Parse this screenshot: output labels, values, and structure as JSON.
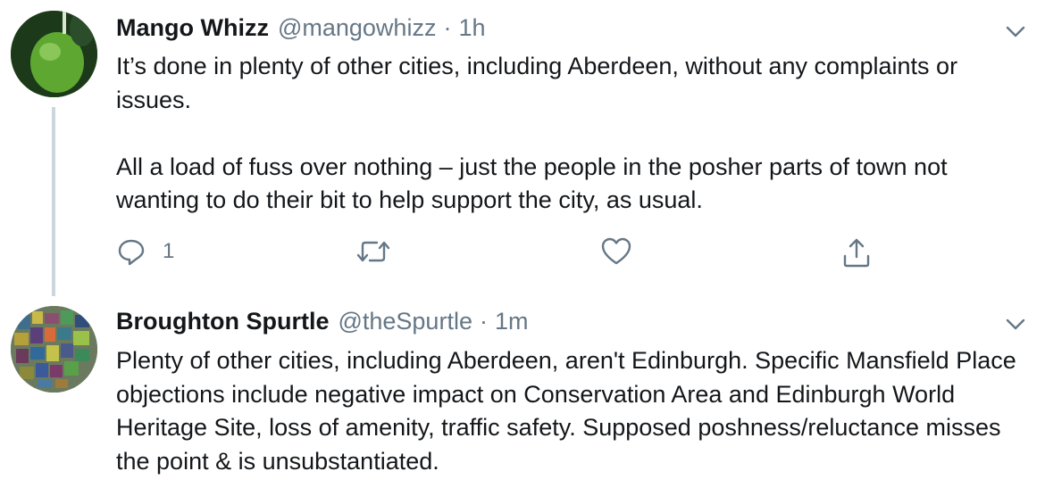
{
  "tweets": [
    {
      "display_name": "Mango Whizz",
      "handle": "@mangowhizz",
      "separator": "·",
      "time": "1h",
      "paragraphs": [
        "It’s done in plenty of other cities, including Aberdeen, without any complaints or issues.",
        "All a load of fuss over nothing – just the people in the posher parts of town not wanting to do their bit to help support the city, as usual."
      ],
      "reply_count": "1",
      "avatar_icon": "green-fruit-avatar"
    },
    {
      "display_name": "Broughton Spurtle",
      "handle": "@theSpurtle",
      "separator": "·",
      "time": "1m",
      "paragraphs": [
        "Plenty of other cities, including Aberdeen, aren't Edinburgh. Specific Mansfield Place objections include negative impact on Conservation Area and Edinburgh World Heritage Site, loss of amenity, traffic safety. Supposed poshness/reluctance misses the point & is unsubstantiated."
      ],
      "avatar_icon": "mosaic-avatar"
    }
  ],
  "icons": {
    "reply": "reply-icon",
    "retweet": "retweet-icon",
    "like": "heart-icon",
    "share": "share-icon",
    "more": "chevron-down-icon"
  },
  "colors": {
    "text": "#14171a",
    "secondary": "#657786",
    "thread_line": "#ccd6dd"
  }
}
